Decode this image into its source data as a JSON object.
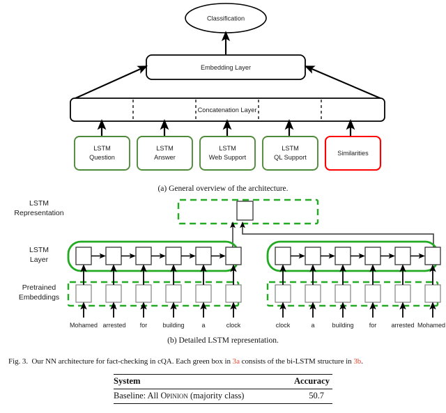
{
  "figure": {
    "caption_prefix": "Fig. 3.",
    "caption_text_1": "Our NN architecture for fact-checking in cQA. Each green box in ",
    "caption_ref_1": "3a",
    "caption_text_2": " consists of the bi-LSTM structure in ",
    "caption_ref_2": "3b",
    "caption_text_3": ".",
    "ref_color": "#e8452c"
  },
  "subfigure_a": {
    "caption": "(a) General overview of the architecture.",
    "classification_node": "Classification",
    "embedding_layer": "Embedding Layer",
    "concatenation_layer": "Concatenation Layer",
    "input_boxes": [
      {
        "line1": "LSTM",
        "line2": "Question",
        "color": "#4f8a3a"
      },
      {
        "line1": "LSTM",
        "line2": "Answer",
        "color": "#4f8a3a"
      },
      {
        "line1": "LSTM",
        "line2": "Web Support",
        "color": "#4f8a3a"
      },
      {
        "line1": "LSTM",
        "line2": "QL Support",
        "color": "#4f8a3a"
      },
      {
        "line1": "Similarities",
        "line2": "",
        "color": "#ff0000"
      }
    ]
  },
  "subfigure_b": {
    "caption": "(b) Detailed LSTM representation.",
    "row_labels": [
      {
        "line1": "LSTM",
        "line2": "Representation"
      },
      {
        "line1": "LSTM",
        "line2": "Layer"
      },
      {
        "line1": "Pretrained",
        "line2": "Embeddings"
      }
    ],
    "forward_tokens": [
      "Mohamed",
      "arrested",
      "for",
      "building",
      "a",
      "clock"
    ],
    "backward_tokens": [
      "clock",
      "a",
      "building",
      "for",
      "arrested",
      "Mohamed"
    ],
    "green_solid": "#22aa22",
    "green_dashed": "#22aa22"
  },
  "table": {
    "headers": [
      "System",
      "Accuracy"
    ],
    "rows": [
      {
        "system_pre": "Baseline: All ",
        "system_sc": "Opinion",
        "system_post": " (majority class)",
        "accuracy": "50.7"
      }
    ]
  }
}
